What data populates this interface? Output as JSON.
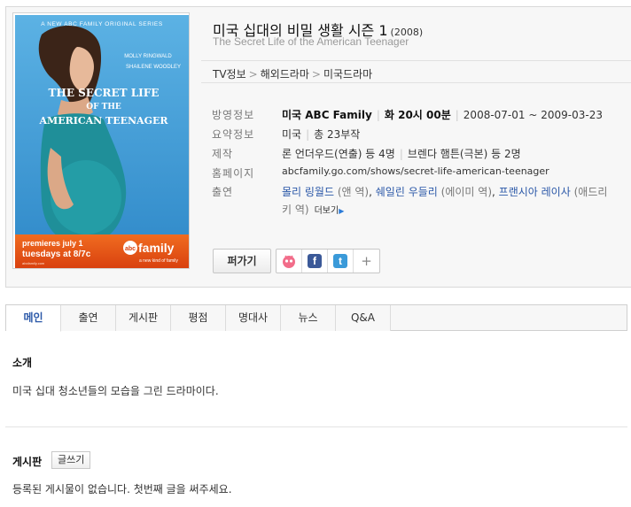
{
  "show": {
    "title": "미국 십대의 비밀 생활 시즌 1",
    "year": "(2008)",
    "subtitle": "The Secret Life of the American Teenager"
  },
  "poster": {
    "top_line": "A NEW ABC FAMILY ORIGINAL SERIES",
    "cast_1": "MOLLY RINGWALD",
    "cast_2": "SHAILENE WOODLEY",
    "title_line_1": "THE SECRET LIFE",
    "title_line_2": "OF THE",
    "title_line_3": "AMERICAN TEENAGER",
    "premiere_1": "premieres july 1",
    "premiere_2": "tuesdays at 8/7c",
    "small_url": "abcfamily.com",
    "brand_abc": "abc",
    "brand_family": "family",
    "brand_tagline": "a new kind of family"
  },
  "breadcrumb": [
    "TV정보",
    "해외드라마",
    "미국드라마"
  ],
  "info": {
    "broadcast": {
      "label": "방영정보",
      "channel": "미국 ABC Family",
      "time": "화 20시 00분",
      "period": "2008-07-01 ~ 2009-03-23"
    },
    "summary": {
      "label": "요약정보",
      "country": "미국",
      "episodes": "총 23부작"
    },
    "production": {
      "label": "제작",
      "director": "론 언더우드(연출) 등 4명",
      "writer": "브렌다 햄튼(극본) 등 2명"
    },
    "homepage": {
      "label": "홈페이지",
      "url": "abcfamily.go.com/shows/secret-life-american-teenager"
    },
    "cast": {
      "label": "출연",
      "actor_1": "몰리 링월드",
      "role_1": "(앤 역)",
      "sep_1": ",",
      "actor_2": "쉐일린 우들리",
      "role_2": "(에이미 역)",
      "sep_2": ",",
      "actor_3": "프랜시아 레이사",
      "role_3_start": "(애드리",
      "role_3_end": "키 역)",
      "more": "더보기"
    }
  },
  "actions": {
    "share_label": "퍼가기",
    "facebook": "f",
    "twitter": "t",
    "more": "+"
  },
  "tabs": [
    "메인",
    "출연",
    "게시판",
    "평점",
    "명대사",
    "뉴스",
    "Q&A"
  ],
  "intro": {
    "title": "소개",
    "text": "미국 십대 청소년들의 모습을 그린 드라마이다."
  },
  "board": {
    "title": "게시판",
    "write_label": "글쓰기",
    "empty_text": "등록된 게시물이 없습니다. 첫번째 글을 써주세요."
  },
  "colors": {
    "link": "#2b58a8",
    "poster_bg": "#3d9bd6",
    "poster_banner": "#ea5a1b"
  }
}
